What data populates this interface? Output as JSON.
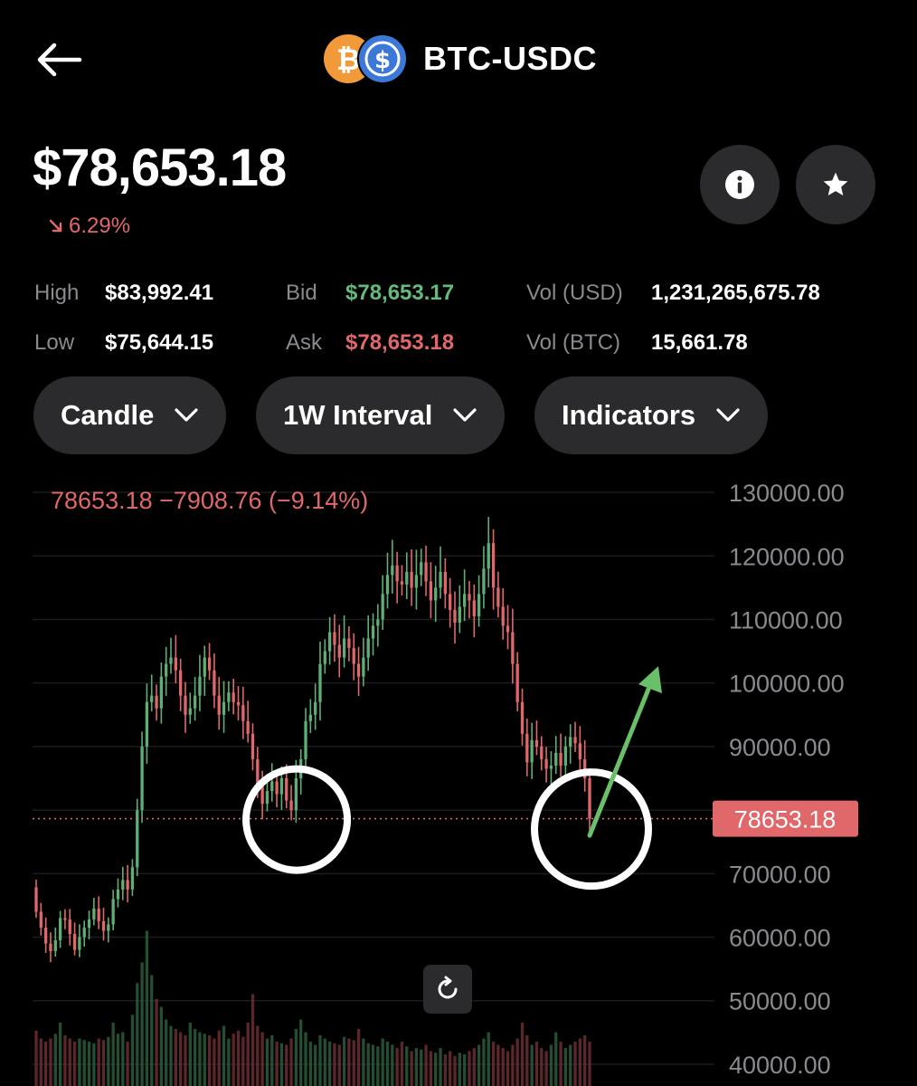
{
  "header": {
    "title": "BTC-USDC",
    "back_icon": "arrow-left-icon",
    "logos": [
      "bitcoin-icon",
      "usdc-icon"
    ]
  },
  "price": {
    "value": "$78,653.18",
    "change": "6.29%",
    "direction": "down"
  },
  "stats": {
    "high_label": "High",
    "high_value": "$83,992.41",
    "low_label": "Low",
    "low_value": "$75,644.15",
    "bid_label": "Bid",
    "bid_value": "$78,653.17",
    "ask_label": "Ask",
    "ask_value": "$78,653.18",
    "vol_usd_label": "Vol (USD)",
    "vol_usd_value": "1,231,265,675.78",
    "vol_btc_label": "Vol (BTC)",
    "vol_btc_value": "15,661.78"
  },
  "controls": {
    "chart_type": "Candle",
    "interval": "1W Interval",
    "indicators": "Indicators"
  },
  "colors": {
    "up": "#5fae76",
    "down": "#e0676a",
    "bg": "#000000",
    "button_bg": "#2b2b2e",
    "annotation_arrow": "#6abf69"
  },
  "chart_data": {
    "type": "candlestick",
    "title": "",
    "legend_text": "78653.18  −7908.76 (−9.14%)",
    "current_price_label": "78653.18",
    "y_ticks": [
      "130000.00",
      "120000.00",
      "110000.00",
      "100000.00",
      "90000.00",
      "80000.00",
      "70000.00",
      "60000.00",
      "50000.00",
      "40000.00"
    ],
    "ylim": [
      38000,
      132000
    ],
    "current_price": 78653.18,
    "annotations": [
      {
        "type": "circle",
        "label": "support-low-circle"
      },
      {
        "type": "circle",
        "label": "current-low-circle"
      },
      {
        "type": "arrow",
        "direction": "up",
        "label": "projection-arrow"
      }
    ],
    "closes": [
      64000,
      61500,
      59000,
      57800,
      59500,
      63000,
      62800,
      60500,
      58000,
      60000,
      61500,
      62800,
      64500,
      62500,
      61000,
      62000,
      66000,
      67500,
      69000,
      67500,
      71000,
      80000,
      90000,
      97000,
      98000,
      96000,
      101000,
      103000,
      104000,
      102000,
      98000,
      95000,
      96000,
      98000,
      101000,
      104000,
      102000,
      98000,
      95000,
      97000,
      98500,
      97000,
      96500,
      94000,
      92000,
      88000,
      84000,
      81000,
      83000,
      84500,
      82500,
      85000,
      81500,
      80000,
      85000,
      88000,
      94000,
      95000,
      97000,
      103000,
      105000,
      108000,
      106000,
      104000,
      107000,
      105500,
      103000,
      101000,
      104000,
      107000,
      109000,
      110000,
      114000,
      117000,
      118500,
      116000,
      115500,
      117500,
      115000,
      117000,
      119000,
      116000,
      113000,
      115000,
      117500,
      114000,
      111500,
      109500,
      112000,
      114000,
      113000,
      110500,
      114000,
      118000,
      122000,
      115000,
      112000,
      109000,
      108000,
      103000,
      97000,
      92000,
      87500,
      91000,
      90000,
      88000,
      86500,
      87000,
      89000,
      87000,
      90000,
      91500,
      90500,
      88000,
      85000,
      78653
    ],
    "volumes": [
      0.35,
      0.3,
      0.28,
      0.3,
      0.33,
      0.4,
      0.32,
      0.3,
      0.28,
      0.3,
      0.29,
      0.28,
      0.27,
      0.3,
      0.29,
      0.31,
      0.4,
      0.33,
      0.34,
      0.28,
      0.45,
      0.65,
      0.78,
      0.98,
      0.7,
      0.55,
      0.5,
      0.42,
      0.38,
      0.36,
      0.34,
      0.32,
      0.4,
      0.36,
      0.34,
      0.33,
      0.32,
      0.3,
      0.35,
      0.38,
      0.3,
      0.33,
      0.35,
      0.31,
      0.4,
      0.58,
      0.38,
      0.34,
      0.3,
      0.32,
      0.28,
      0.27,
      0.26,
      0.3,
      0.36,
      0.42,
      0.34,
      0.28,
      0.26,
      0.32,
      0.3,
      0.28,
      0.27,
      0.26,
      0.31,
      0.3,
      0.29,
      0.36,
      0.3,
      0.27,
      0.26,
      0.25,
      0.3,
      0.28,
      0.26,
      0.24,
      0.28,
      0.25,
      0.22,
      0.24,
      0.23,
      0.26,
      0.22,
      0.21,
      0.24,
      0.2,
      0.22,
      0.19,
      0.21,
      0.2,
      0.22,
      0.24,
      0.26,
      0.3,
      0.34,
      0.28,
      0.26,
      0.24,
      0.22,
      0.26,
      0.3,
      0.4,
      0.32,
      0.26,
      0.28,
      0.24,
      0.22,
      0.26,
      0.34,
      0.28,
      0.24,
      0.26,
      0.28,
      0.3,
      0.32,
      0.28
    ]
  }
}
